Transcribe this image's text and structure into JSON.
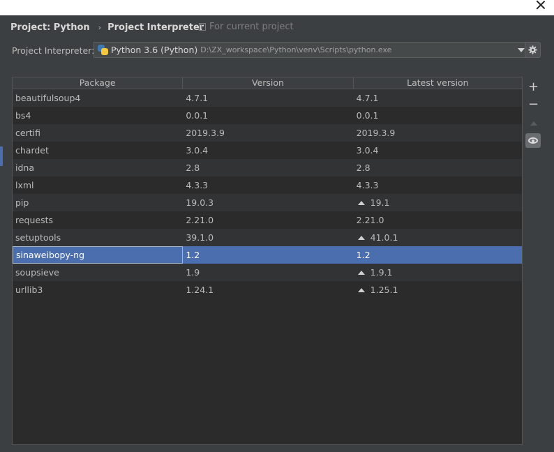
{
  "breadcrumb": {
    "project": "Project: Python",
    "separator": "›",
    "page": "Project Interpreter"
  },
  "scope_label": "For current project",
  "interpreter": {
    "label": "Project Interpreter:",
    "name": "Python 3.6 (Python)",
    "path": "D:\\ZX_workspace\\Python\\venv\\Scripts\\python.exe"
  },
  "table": {
    "headers": [
      "Package",
      "Version",
      "Latest version"
    ],
    "rows": [
      {
        "package": "beautifulsoup4",
        "version": "4.7.1",
        "latest": "4.7.1",
        "upgrade": false
      },
      {
        "package": "bs4",
        "version": "0.0.1",
        "latest": "0.0.1",
        "upgrade": false
      },
      {
        "package": "certifi",
        "version": "2019.3.9",
        "latest": "2019.3.9",
        "upgrade": false
      },
      {
        "package": "chardet",
        "version": "3.0.4",
        "latest": "3.0.4",
        "upgrade": false
      },
      {
        "package": "idna",
        "version": "2.8",
        "latest": "2.8",
        "upgrade": false
      },
      {
        "package": "lxml",
        "version": "4.3.3",
        "latest": "4.3.3",
        "upgrade": false
      },
      {
        "package": "pip",
        "version": "19.0.3",
        "latest": "19.1",
        "upgrade": true
      },
      {
        "package": "requests",
        "version": "2.21.0",
        "latest": "2.21.0",
        "upgrade": false
      },
      {
        "package": "setuptools",
        "version": "39.1.0",
        "latest": "41.0.1",
        "upgrade": true
      },
      {
        "package": "sinaweibopy-ng",
        "version": "1.2",
        "latest": "1.2",
        "upgrade": false
      },
      {
        "package": "soupsieve",
        "version": "1.9",
        "latest": "1.9.1",
        "upgrade": true
      },
      {
        "package": "urllib3",
        "version": "1.24.1",
        "latest": "1.25.1",
        "upgrade": true
      }
    ],
    "selected_index": 9
  },
  "toolbar": {
    "add_symbol": "+",
    "remove_symbol": "−",
    "icons": [
      "plus-icon",
      "minus-icon",
      "upgrade-arrow-icon",
      "eye-icon"
    ]
  },
  "colors": {
    "background": "#3c3f41",
    "selection": "#4b6eaf",
    "table_bg": "#2b2b2b"
  }
}
